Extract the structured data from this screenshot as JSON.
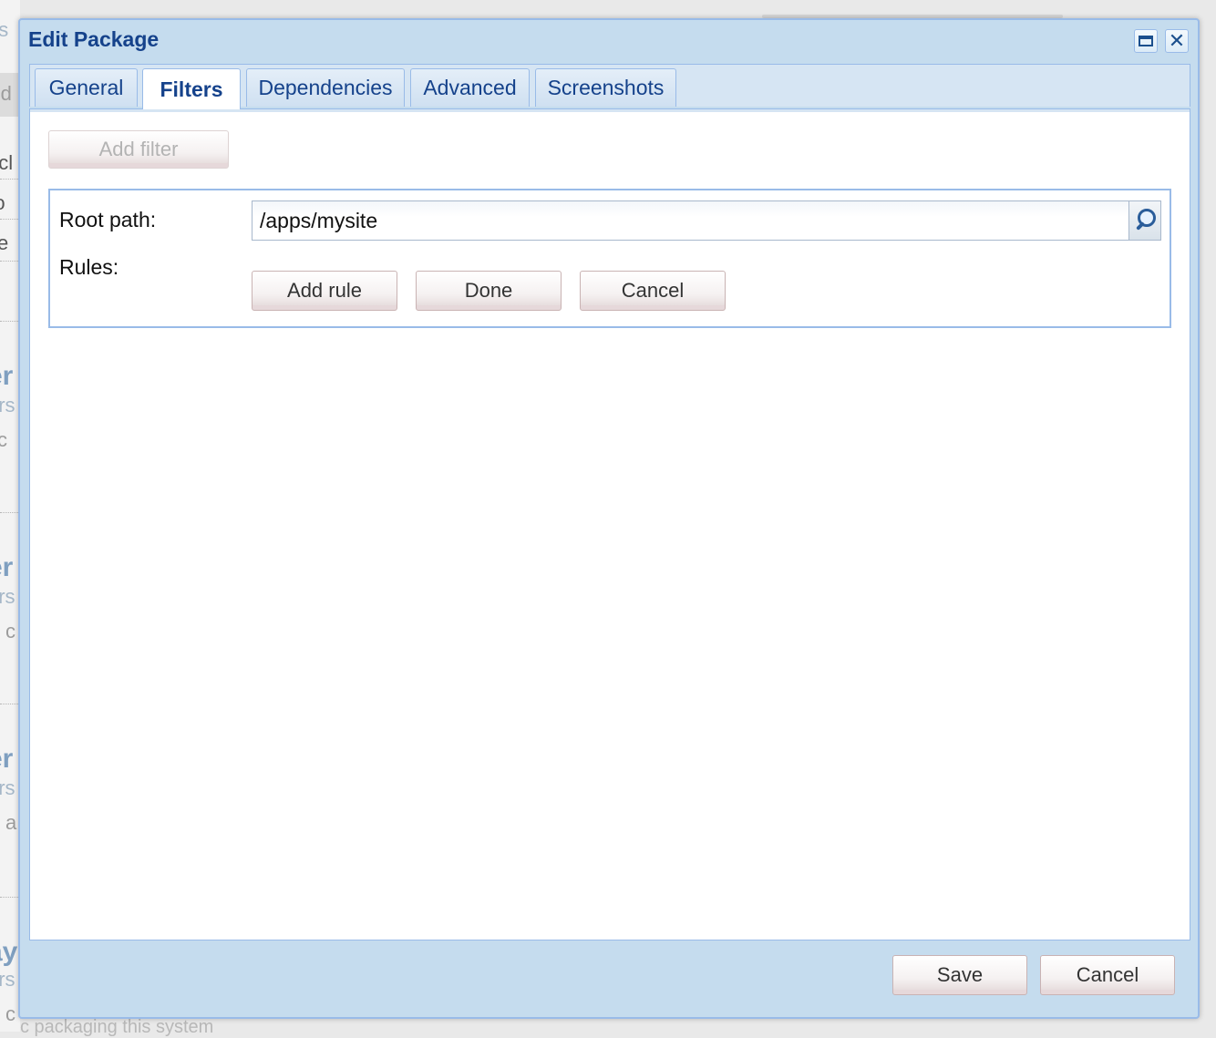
{
  "background": {
    "fragments": [
      "es",
      "Ed",
      "acl",
      "ro",
      "ite",
      "er",
      "ers",
      "l c",
      "er",
      "ers",
      "c",
      "er",
      "ers",
      "a",
      "ay",
      "ers",
      "c"
    ],
    "bottom_text": "c      packaging this system"
  },
  "dialog": {
    "title": "Edit Package",
    "tools": {
      "maximize": "maximize-icon",
      "close": "close-icon"
    },
    "tabs": [
      {
        "label": "General",
        "active": false
      },
      {
        "label": "Filters",
        "active": true
      },
      {
        "label": "Dependencies",
        "active": false
      },
      {
        "label": "Advanced",
        "active": false
      },
      {
        "label": "Screenshots",
        "active": false
      }
    ],
    "filters": {
      "add_filter_label": "Add filter",
      "root_path_label": "Root path:",
      "root_path_value": "/apps/mysite",
      "rules_label": "Rules:",
      "add_rule_label": "Add rule",
      "done_label": "Done",
      "cancel_label": "Cancel"
    },
    "footer": {
      "save_label": "Save",
      "cancel_label": "Cancel"
    }
  },
  "colors": {
    "title_text": "#15428b",
    "window_frame": "#c5dcee",
    "border": "#99bbe8"
  }
}
